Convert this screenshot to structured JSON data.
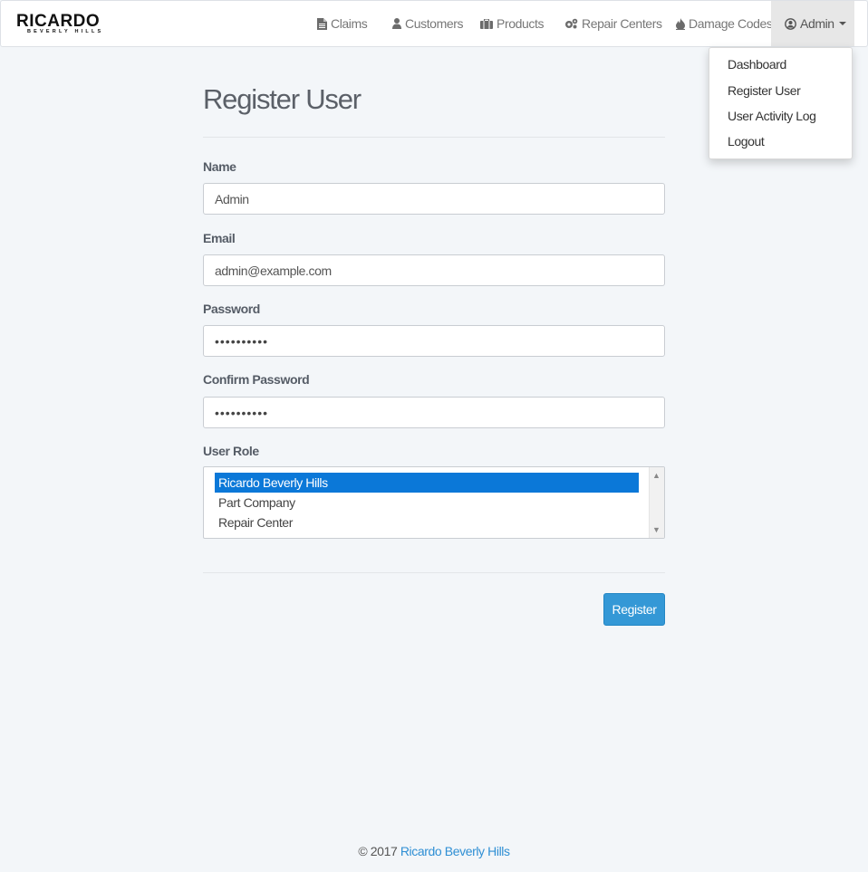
{
  "brand": {
    "name": "RICARDO",
    "sub": "BEVERLY HILLS"
  },
  "nav": {
    "claims": "Claims",
    "customers": "Customers",
    "products": "Products",
    "repair_centers": "Repair Centers",
    "damage_codes": "Damage Codes",
    "user": "Admin"
  },
  "icons": {
    "claims": "file-icon",
    "customers": "user-icon",
    "products": "briefcase-icon",
    "repair_centers": "gears-icon",
    "damage_codes": "fire-icon",
    "user": "user-circle-icon"
  },
  "dropdown": {
    "dashboard": "Dashboard",
    "register_user": "Register User",
    "activity_log": "User Activity Log",
    "logout": "Logout"
  },
  "form": {
    "title": "Register User",
    "name_label": "Name",
    "name_value": "Admin",
    "email_label": "Email",
    "email_value": "admin@example.com",
    "password_label": "Password",
    "password_value": "••••••••••",
    "confirm_label": "Confirm Password",
    "confirm_value": "••••••••••",
    "role_label": "User Role",
    "roles": [
      "Ricardo Beverly Hills",
      "Part Company",
      "Repair Center"
    ],
    "selected_role": "Ricardo Beverly Hills",
    "submit": "Register"
  },
  "footer": {
    "copyright": "© 2017",
    "link": "Ricardo Beverly Hills"
  },
  "colors": {
    "primary": "#3498d6",
    "selected": "#0b78d8",
    "link": "#2f8fd4",
    "background": "#f3f6f9"
  }
}
